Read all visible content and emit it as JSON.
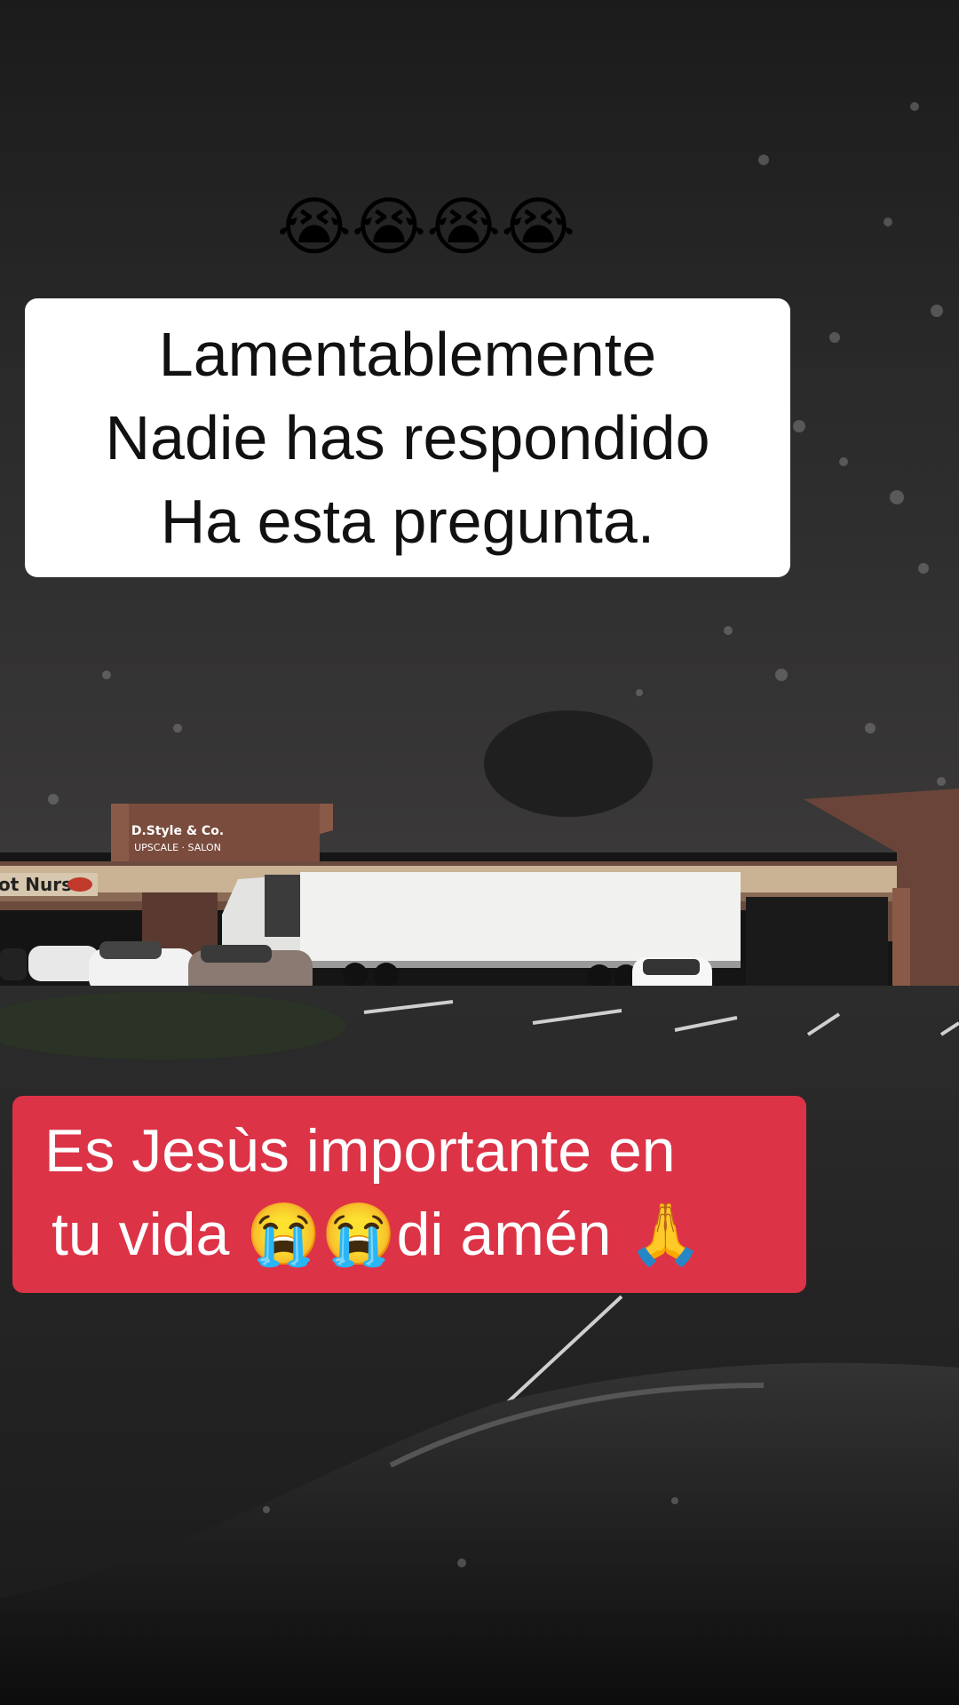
{
  "top_emojis": "😭😭😭😭",
  "caption_white": {
    "lines": [
      "Lamentablemente",
      "Nadie has respondido",
      "Ha esta pregunta."
    ]
  },
  "caption_red": {
    "lines": [
      "Es Jesùs importante en",
      "tu vida 😭😭di amén 🙏"
    ]
  },
  "signs": {
    "salon_name": "D.Style & Co.",
    "salon_sub": "UPSCALE · SALON",
    "store_left": "ot Nurse"
  },
  "colors": {
    "red_box": "#dc3347",
    "white_box": "#ffffff"
  }
}
